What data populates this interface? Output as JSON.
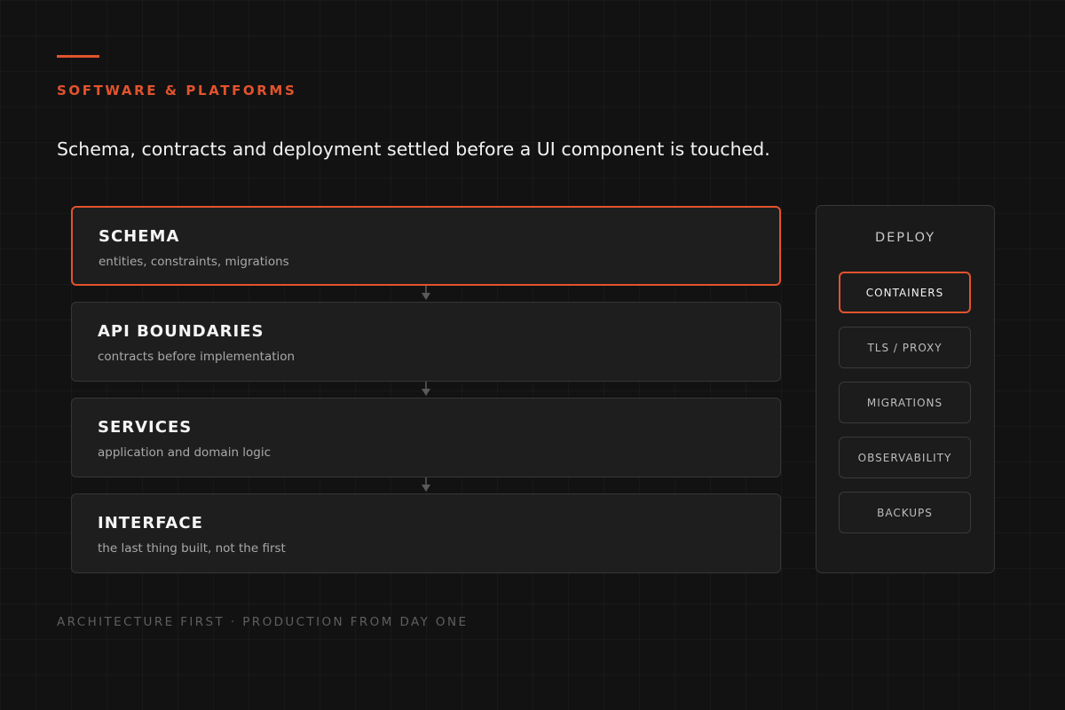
{
  "header": {
    "eyebrow": "SOFTWARE & PLATFORMS",
    "headline": "Schema, contracts and deployment settled before a UI component is touched."
  },
  "layers": [
    {
      "title": "SCHEMA",
      "subtitle": "entities, constraints, migrations",
      "active": true
    },
    {
      "title": "API BOUNDARIES",
      "subtitle": "contracts before implementation",
      "active": false
    },
    {
      "title": "SERVICES",
      "subtitle": "application and domain logic",
      "active": false
    },
    {
      "title": "INTERFACE",
      "subtitle": "the last thing built, not the first",
      "active": false
    }
  ],
  "deploy": {
    "title": "DEPLOY",
    "items": [
      {
        "label": "CONTAINERS",
        "active": true
      },
      {
        "label": "TLS / PROXY",
        "active": false
      },
      {
        "label": "MIGRATIONS",
        "active": false
      },
      {
        "label": "OBSERVABILITY",
        "active": false
      },
      {
        "label": "BACKUPS",
        "active": false
      }
    ]
  },
  "footer": {
    "tagline": "ARCHITECTURE FIRST · PRODUCTION FROM DAY ONE"
  },
  "colors": {
    "accent": "#e2532d",
    "background": "#121212",
    "card": "#1e1e1e",
    "border": "#363636"
  }
}
